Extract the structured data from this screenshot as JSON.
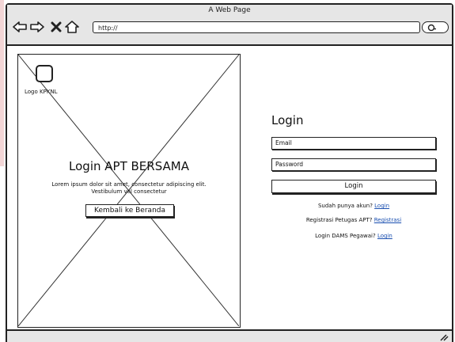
{
  "window": {
    "title": "A Web Page",
    "address": "http://"
  },
  "toolbar": {
    "back_icon": "back-arrow-icon",
    "forward_icon": "forward-arrow-icon",
    "stop_icon": "close-icon",
    "home_icon": "home-icon",
    "search_icon": "search-icon"
  },
  "hero": {
    "logo_label": "Logo KPKNL",
    "title": "Login APT BERSAMA",
    "description": "Lorem ipsum dolor sit amet, consectetur adipiscing elit. Vestibulum vel consectetur",
    "back_button": "Kembali ke Beranda"
  },
  "login": {
    "heading": "Login",
    "email_placeholder": "Email",
    "password_placeholder": "Password",
    "submit_label": "Login",
    "links": [
      {
        "text": "Sudah punya akun?",
        "link": "Login"
      },
      {
        "text": "Registrasi Petugas APT?",
        "link": "Registrasi"
      },
      {
        "text": "Login DAMS Pegawai?",
        "link": "Login"
      }
    ]
  },
  "colors": {
    "link": "#1a4fb0",
    "chrome": "#e6e6e6",
    "accent_edge": "#f3d6d6"
  }
}
